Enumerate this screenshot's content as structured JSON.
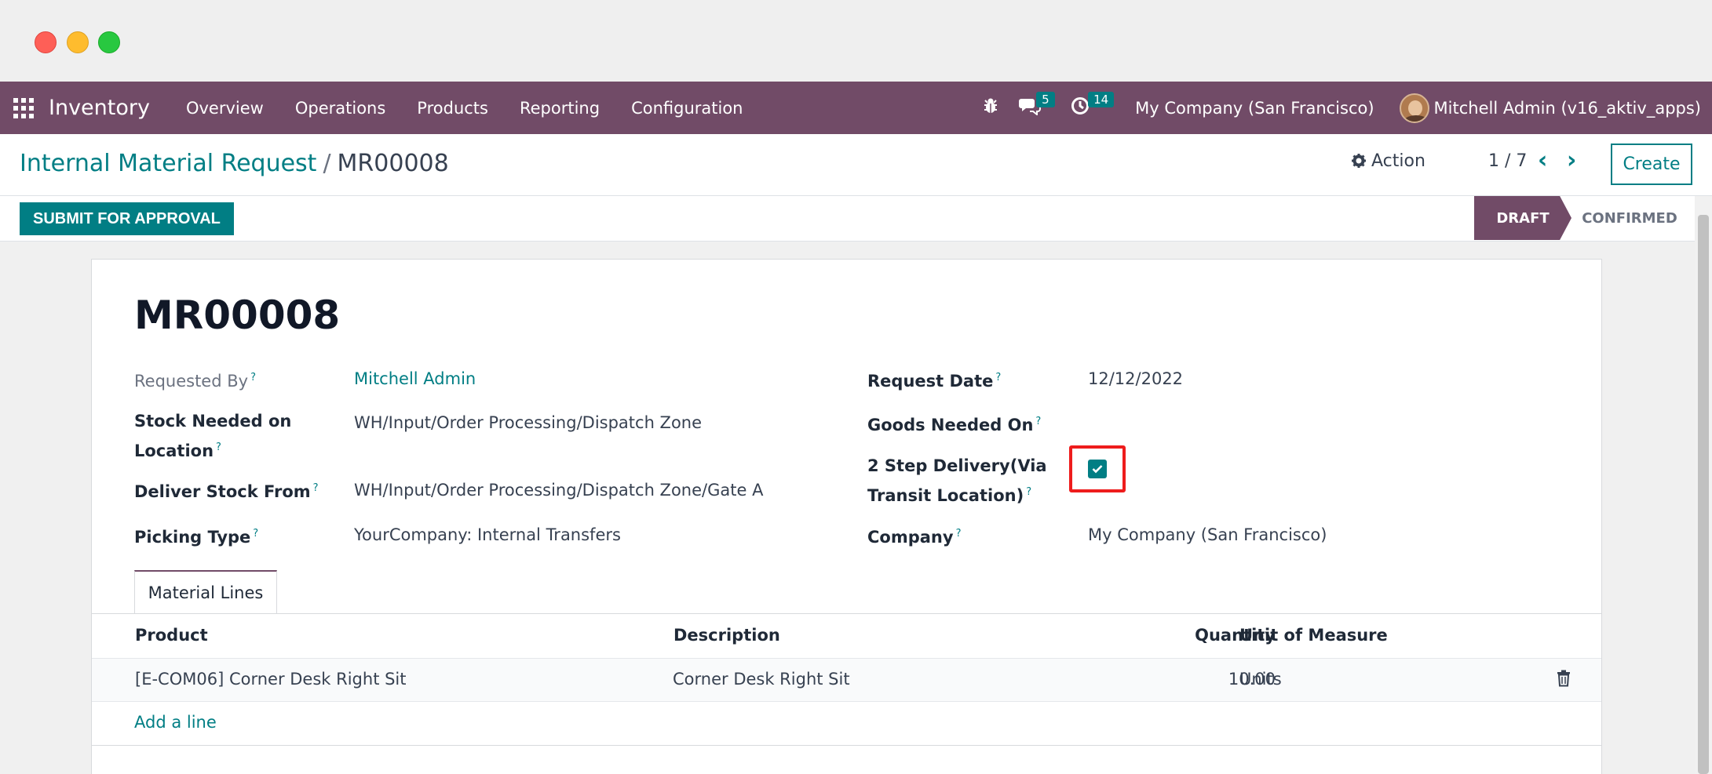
{
  "navbar": {
    "app_name": "Inventory",
    "menu": [
      "Overview",
      "Operations",
      "Products",
      "Reporting",
      "Configuration"
    ],
    "messages_count": "5",
    "activities_count": "14",
    "company": "My Company (San Francisco)",
    "user": "Mitchell Admin (v16_aktiv_apps)"
  },
  "control": {
    "breadcrumb_parent": "Internal Material Request",
    "breadcrumb_sep": "/",
    "breadcrumb_current": "MR00008",
    "action_label": "Action",
    "pager": "1 / 7",
    "create_label": "Create"
  },
  "statusbar": {
    "submit_label": "SUBMIT FOR APPROVAL",
    "stages": [
      "DRAFT",
      "CONFIRMED"
    ],
    "active_stage": "DRAFT"
  },
  "form": {
    "title": "MR00008",
    "requested_by_label": "Requested By",
    "requested_by": "Mitchell Admin",
    "stock_needed_label_1": "Stock Needed on",
    "stock_needed_label_2": "Location",
    "stock_needed": "WH/Input/Order Processing/Dispatch Zone",
    "deliver_from_label": "Deliver Stock From",
    "deliver_from": "WH/Input/Order Processing/Dispatch Zone/Gate A",
    "picking_type_label": "Picking Type",
    "picking_type": "YourCompany: Internal Transfers",
    "request_date_label": "Request Date",
    "request_date": "12/12/2022",
    "goods_needed_label": "Goods Needed On",
    "goods_needed": "",
    "two_step_label_1": "2 Step Delivery(Via",
    "two_step_label_2": "Transit Location)",
    "two_step_checked": true,
    "company_label": "Company",
    "company": "My Company (San Francisco)",
    "help_mark": "?"
  },
  "lines": {
    "tab_label": "Material Lines",
    "headers": [
      "Product",
      "Description",
      "Quantity",
      "Unit of Measure"
    ],
    "rows": [
      {
        "product": "[E-COM06] Corner Desk Right Sit",
        "description": "Corner Desk Right Sit",
        "quantity": "10.00",
        "uom": "Units"
      }
    ],
    "add_line": "Add a line"
  },
  "colors": {
    "brand": "#714b67",
    "accent": "#017e84",
    "highlight": "#ee1c1c"
  }
}
